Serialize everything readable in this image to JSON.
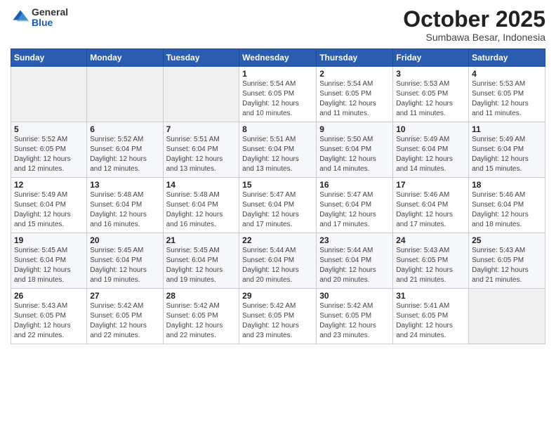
{
  "logo": {
    "general": "General",
    "blue": "Blue"
  },
  "title": "October 2025",
  "subtitle": "Sumbawa Besar, Indonesia",
  "days_of_week": [
    "Sunday",
    "Monday",
    "Tuesday",
    "Wednesday",
    "Thursday",
    "Friday",
    "Saturday"
  ],
  "weeks": [
    [
      {
        "day": "",
        "info": ""
      },
      {
        "day": "",
        "info": ""
      },
      {
        "day": "",
        "info": ""
      },
      {
        "day": "1",
        "info": "Sunrise: 5:54 AM\nSunset: 6:05 PM\nDaylight: 12 hours\nand 10 minutes."
      },
      {
        "day": "2",
        "info": "Sunrise: 5:54 AM\nSunset: 6:05 PM\nDaylight: 12 hours\nand 11 minutes."
      },
      {
        "day": "3",
        "info": "Sunrise: 5:53 AM\nSunset: 6:05 PM\nDaylight: 12 hours\nand 11 minutes."
      },
      {
        "day": "4",
        "info": "Sunrise: 5:53 AM\nSunset: 6:05 PM\nDaylight: 12 hours\nand 11 minutes."
      }
    ],
    [
      {
        "day": "5",
        "info": "Sunrise: 5:52 AM\nSunset: 6:05 PM\nDaylight: 12 hours\nand 12 minutes."
      },
      {
        "day": "6",
        "info": "Sunrise: 5:52 AM\nSunset: 6:04 PM\nDaylight: 12 hours\nand 12 minutes."
      },
      {
        "day": "7",
        "info": "Sunrise: 5:51 AM\nSunset: 6:04 PM\nDaylight: 12 hours\nand 13 minutes."
      },
      {
        "day": "8",
        "info": "Sunrise: 5:51 AM\nSunset: 6:04 PM\nDaylight: 12 hours\nand 13 minutes."
      },
      {
        "day": "9",
        "info": "Sunrise: 5:50 AM\nSunset: 6:04 PM\nDaylight: 12 hours\nand 14 minutes."
      },
      {
        "day": "10",
        "info": "Sunrise: 5:49 AM\nSunset: 6:04 PM\nDaylight: 12 hours\nand 14 minutes."
      },
      {
        "day": "11",
        "info": "Sunrise: 5:49 AM\nSunset: 6:04 PM\nDaylight: 12 hours\nand 15 minutes."
      }
    ],
    [
      {
        "day": "12",
        "info": "Sunrise: 5:49 AM\nSunset: 6:04 PM\nDaylight: 12 hours\nand 15 minutes."
      },
      {
        "day": "13",
        "info": "Sunrise: 5:48 AM\nSunset: 6:04 PM\nDaylight: 12 hours\nand 16 minutes."
      },
      {
        "day": "14",
        "info": "Sunrise: 5:48 AM\nSunset: 6:04 PM\nDaylight: 12 hours\nand 16 minutes."
      },
      {
        "day": "15",
        "info": "Sunrise: 5:47 AM\nSunset: 6:04 PM\nDaylight: 12 hours\nand 17 minutes."
      },
      {
        "day": "16",
        "info": "Sunrise: 5:47 AM\nSunset: 6:04 PM\nDaylight: 12 hours\nand 17 minutes."
      },
      {
        "day": "17",
        "info": "Sunrise: 5:46 AM\nSunset: 6:04 PM\nDaylight: 12 hours\nand 17 minutes."
      },
      {
        "day": "18",
        "info": "Sunrise: 5:46 AM\nSunset: 6:04 PM\nDaylight: 12 hours\nand 18 minutes."
      }
    ],
    [
      {
        "day": "19",
        "info": "Sunrise: 5:45 AM\nSunset: 6:04 PM\nDaylight: 12 hours\nand 18 minutes."
      },
      {
        "day": "20",
        "info": "Sunrise: 5:45 AM\nSunset: 6:04 PM\nDaylight: 12 hours\nand 19 minutes."
      },
      {
        "day": "21",
        "info": "Sunrise: 5:45 AM\nSunset: 6:04 PM\nDaylight: 12 hours\nand 19 minutes."
      },
      {
        "day": "22",
        "info": "Sunrise: 5:44 AM\nSunset: 6:04 PM\nDaylight: 12 hours\nand 20 minutes."
      },
      {
        "day": "23",
        "info": "Sunrise: 5:44 AM\nSunset: 6:04 PM\nDaylight: 12 hours\nand 20 minutes."
      },
      {
        "day": "24",
        "info": "Sunrise: 5:43 AM\nSunset: 6:05 PM\nDaylight: 12 hours\nand 21 minutes."
      },
      {
        "day": "25",
        "info": "Sunrise: 5:43 AM\nSunset: 6:05 PM\nDaylight: 12 hours\nand 21 minutes."
      }
    ],
    [
      {
        "day": "26",
        "info": "Sunrise: 5:43 AM\nSunset: 6:05 PM\nDaylight: 12 hours\nand 22 minutes."
      },
      {
        "day": "27",
        "info": "Sunrise: 5:42 AM\nSunset: 6:05 PM\nDaylight: 12 hours\nand 22 minutes."
      },
      {
        "day": "28",
        "info": "Sunrise: 5:42 AM\nSunset: 6:05 PM\nDaylight: 12 hours\nand 22 minutes."
      },
      {
        "day": "29",
        "info": "Sunrise: 5:42 AM\nSunset: 6:05 PM\nDaylight: 12 hours\nand 23 minutes."
      },
      {
        "day": "30",
        "info": "Sunrise: 5:42 AM\nSunset: 6:05 PM\nDaylight: 12 hours\nand 23 minutes."
      },
      {
        "day": "31",
        "info": "Sunrise: 5:41 AM\nSunset: 6:05 PM\nDaylight: 12 hours\nand 24 minutes."
      },
      {
        "day": "",
        "info": ""
      }
    ]
  ]
}
